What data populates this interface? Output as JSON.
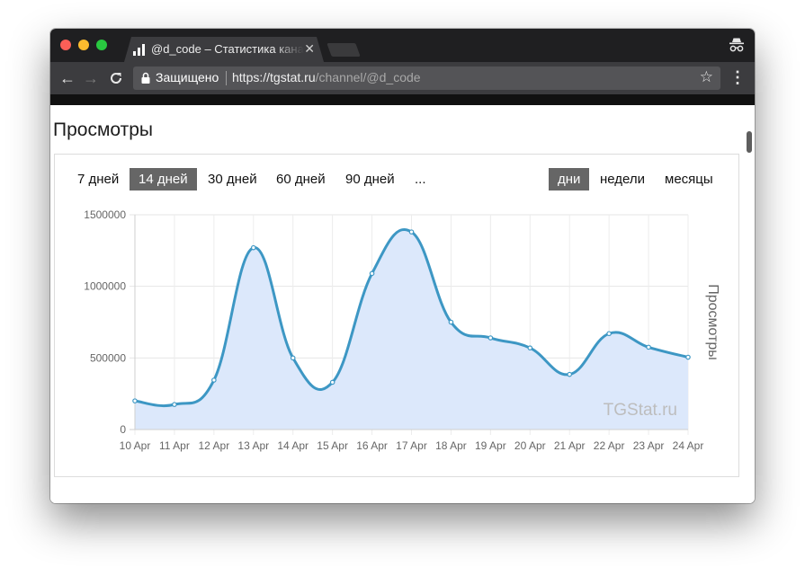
{
  "browser": {
    "tab_title": "@d_code – Статистика канала",
    "tab_close": "✕",
    "nav_back": "←",
    "nav_forward": "→",
    "nav_reload": "C",
    "secure_label": "Защищено",
    "url_host": "https://tgstat.ru",
    "url_path": "/channel/@d_code",
    "bookmark_star": "☆",
    "menu": "⋮"
  },
  "page": {
    "section_title": "Просмотры"
  },
  "range_buttons": [
    {
      "label": "7 дней",
      "active": false
    },
    {
      "label": "14 дней",
      "active": true
    },
    {
      "label": "30 дней",
      "active": false
    },
    {
      "label": "60 дней",
      "active": false
    },
    {
      "label": "90 дней",
      "active": false
    },
    {
      "label": "...",
      "active": false
    }
  ],
  "period_buttons": [
    {
      "label": "дни",
      "active": true
    },
    {
      "label": "недели",
      "active": false
    },
    {
      "label": "месяцы",
      "active": false
    }
  ],
  "colors": {
    "accent_active": "#666666",
    "line": "#3d97c4",
    "area_fill": "#dce8fb",
    "traffic_red": "#fc5f57",
    "traffic_yellow": "#fdbc2e",
    "traffic_green": "#29c840"
  },
  "chart_data": {
    "type": "area",
    "x": [
      "10 Apr",
      "11 Apr",
      "12 Apr",
      "13 Apr",
      "14 Apr",
      "15 Apr",
      "16 Apr",
      "17 Apr",
      "18 Apr",
      "19 Apr",
      "20 Apr",
      "21 Apr",
      "22 Apr",
      "23 Apr",
      "24 Apr"
    ],
    "series": [
      {
        "values": [
          200000,
          175000,
          345000,
          1270000,
          500000,
          330000,
          1090000,
          1380000,
          750000,
          640000,
          570000,
          385000,
          670000,
          575000,
          505000
        ]
      }
    ],
    "ylabel": "Просмотры",
    "xlabel": "",
    "ylim": [
      0,
      1500000
    ],
    "yticks": [
      "1500000",
      "1000000",
      "500000",
      "0"
    ],
    "grid": true,
    "watermark": "TGStat.ru",
    "smooth": true
  }
}
